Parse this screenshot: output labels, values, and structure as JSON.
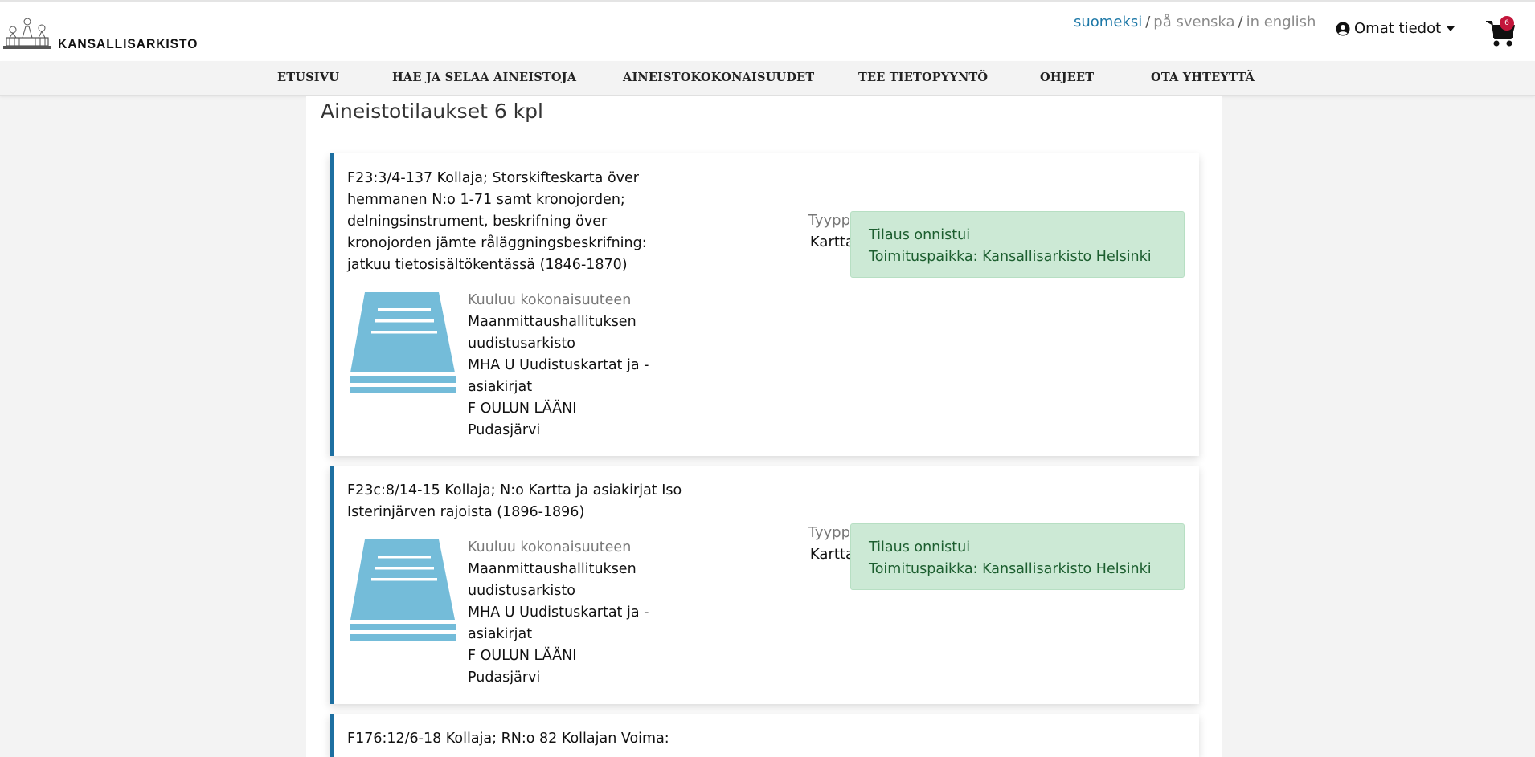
{
  "header": {
    "logo_text": "KANSALLISARKISTO",
    "languages": [
      {
        "label": "suomeksi",
        "active": true
      },
      {
        "label": "på svenska",
        "active": false
      },
      {
        "label": "in english",
        "active": false
      }
    ],
    "separator": "/",
    "user_menu_label": "Omat tiedot",
    "cart_count": "6"
  },
  "nav": {
    "items": [
      "ETUSIVU",
      "HAE JA SELAA AINEISTOJA",
      "AINEISTOKOKONAISUUDET",
      "TEE TIETOPYYNTÖ",
      "OHJEET",
      "OTA YHTEYTTÄ"
    ]
  },
  "page": {
    "title": "Aineistotilaukset 6 kpl"
  },
  "orders": [
    {
      "title": "F23:3/4-137 Kollaja; Storskifteskarta över hemmanen N:o 1-71 samt kronojorden; delningsinstrument, beskrifning över kronojorden jämte råläggningsbeskrifning: jatkuu tietosisältökentässä (1846-1870)",
      "collection_label": "Kuuluu kokonaisuuteen",
      "collection": [
        "Maanmittaushallituksen uudistusarkisto",
        "MHA U Uudistuskartat ja -asiakirjat",
        "F OULUN LÄÄNI",
        "Pudasjärvi"
      ],
      "type_label": "Tyyppi",
      "type_value": "Kartta",
      "status": "Tilaus onnistui",
      "delivery": "Toimituspaikka: Kansallisarkisto Helsinki"
    },
    {
      "title": "F23c:8/14-15 Kollaja; N:o Kartta ja asiakirjat Iso Isterinjärven rajoista (1896-1896)",
      "collection_label": "Kuuluu kokonaisuuteen",
      "collection": [
        "Maanmittaushallituksen uudistusarkisto",
        "MHA U Uudistuskartat ja -asiakirjat",
        "F OULUN LÄÄNI",
        "Pudasjärvi"
      ],
      "type_label": "Tyyppi",
      "type_value": "Kartta",
      "status": "Tilaus onnistui",
      "delivery": "Toimituspaikka: Kansallisarkisto Helsinki"
    },
    {
      "title": "F176:12/6-18 Kollaja; RN:o 82 Kollajan Voima:"
    }
  ],
  "colors": {
    "accent": "#1d6fa1",
    "success_bg": "#cce9d5",
    "success_text": "#1c5e2f",
    "badge": "#c3163b",
    "doc_icon": "#74bcd9"
  },
  "icons": {
    "user": "user-circle-icon",
    "cart": "shopping-cart-icon",
    "doc": "archive-document-icon"
  }
}
